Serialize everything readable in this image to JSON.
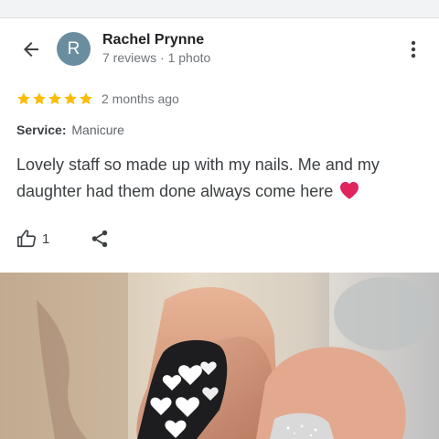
{
  "reviewer": {
    "initial": "R",
    "name": "Rachel Prynne",
    "reviews": "7 reviews",
    "separator": " · ",
    "photos": "1 photo"
  },
  "icons": {
    "back": "arrow-back-icon",
    "menu": "more-vert-icon",
    "star": "star-icon",
    "like": "thumb-up-icon",
    "share": "share-icon",
    "heart": "red-heart-emoji"
  },
  "colors": {
    "star": "#fbbc04",
    "avatar": "#6b8da0",
    "heart": "#e0245e"
  },
  "rating": {
    "stars": 5,
    "time": "2 months ago"
  },
  "service": {
    "label": "Service:",
    "value": "Manicure"
  },
  "review": {
    "text": "Lovely staff so made up with my nails. Me and my daughter had them done always come here"
  },
  "actions": {
    "like_count": "1"
  }
}
